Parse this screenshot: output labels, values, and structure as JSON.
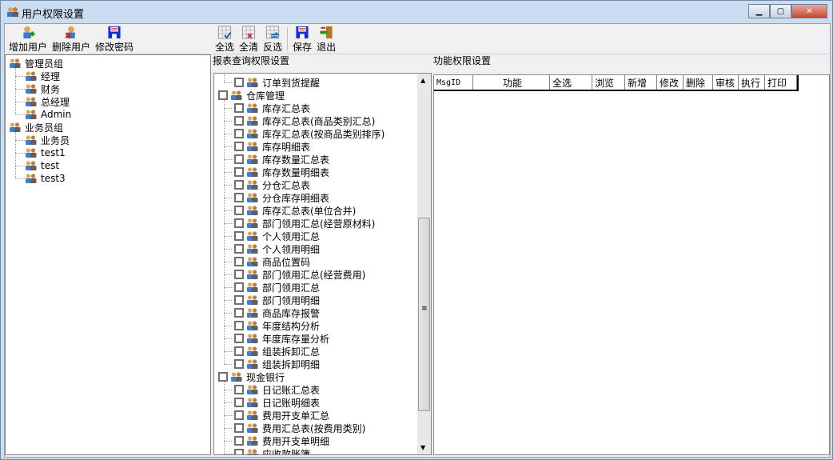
{
  "window": {
    "title": "用户权限设置",
    "controls": [
      "minimize",
      "maximize",
      "close"
    ]
  },
  "toolbar_left": [
    {
      "label": "增加用户",
      "icon": "add-user-icon"
    },
    {
      "label": "删除用户",
      "icon": "delete-user-icon"
    },
    {
      "label": "修改密码",
      "icon": "save-disk-icon"
    }
  ],
  "toolbar_mid": [
    {
      "label": "全选",
      "icon": "grid-check-icon"
    },
    {
      "label": "全清",
      "icon": "grid-clear-icon"
    },
    {
      "label": "反选",
      "icon": "grid-invert-icon"
    },
    {
      "label": "保存",
      "icon": "save-disk-icon"
    },
    {
      "label": "退出",
      "icon": "exit-door-icon"
    }
  ],
  "user_tree": [
    {
      "label": "管理员组",
      "level": 0
    },
    {
      "label": "经理",
      "level": 1
    },
    {
      "label": "财务",
      "level": 1
    },
    {
      "label": "总经理",
      "level": 1
    },
    {
      "label": "Admin",
      "level": 1
    },
    {
      "label": "业务员组",
      "level": 0
    },
    {
      "label": "业务员",
      "level": 1
    },
    {
      "label": "test1",
      "level": 1
    },
    {
      "label": "test",
      "level": 1
    },
    {
      "label": "test3",
      "level": 1
    }
  ],
  "report_section": {
    "title": "报表查询权限设置"
  },
  "report_tree": [
    {
      "label": "订单到货提醒",
      "level": 1
    },
    {
      "label": "仓库管理",
      "level": 0
    },
    {
      "label": "库存汇总表",
      "level": 1
    },
    {
      "label": "库存汇总表(商品类别汇总)",
      "level": 1
    },
    {
      "label": "库存汇总表(按商品类别排序)",
      "level": 1
    },
    {
      "label": "库存明细表",
      "level": 1
    },
    {
      "label": "库存数量汇总表",
      "level": 1
    },
    {
      "label": "库存数量明细表",
      "level": 1
    },
    {
      "label": "分仓汇总表",
      "level": 1
    },
    {
      "label": "分仓库存明细表",
      "level": 1
    },
    {
      "label": "库存汇总表(单位合并)",
      "level": 1
    },
    {
      "label": "部门领用汇总(经营原材料)",
      "level": 1
    },
    {
      "label": "个人领用汇总",
      "level": 1
    },
    {
      "label": "个人领用明细",
      "level": 1
    },
    {
      "label": "商品位置码",
      "level": 1
    },
    {
      "label": "部门领用汇总(经营费用)",
      "level": 1
    },
    {
      "label": "部门领用汇总",
      "level": 1
    },
    {
      "label": "部门领用明细",
      "level": 1
    },
    {
      "label": "商品库存报警",
      "level": 1
    },
    {
      "label": "年度结构分析",
      "level": 1
    },
    {
      "label": "年度库存量分析",
      "level": 1
    },
    {
      "label": "组装拆卸汇总",
      "level": 1
    },
    {
      "label": "组装拆卸明细",
      "level": 1
    },
    {
      "label": "现金银行",
      "level": 0
    },
    {
      "label": "日记账汇总表",
      "level": 1
    },
    {
      "label": "日记账明细表",
      "level": 1
    },
    {
      "label": "费用开支单汇总",
      "level": 1
    },
    {
      "label": "费用汇总表(按费用类别)",
      "level": 1
    },
    {
      "label": "费用开支单明细",
      "level": 1
    },
    {
      "label": "应收款账簿",
      "level": 1
    }
  ],
  "function_section": {
    "title": "功能权限设置",
    "columns": [
      "MsgID",
      "功能",
      "全选",
      "浏览",
      "新增",
      "修改",
      "删除",
      "审核",
      "执行",
      "打印"
    ]
  }
}
